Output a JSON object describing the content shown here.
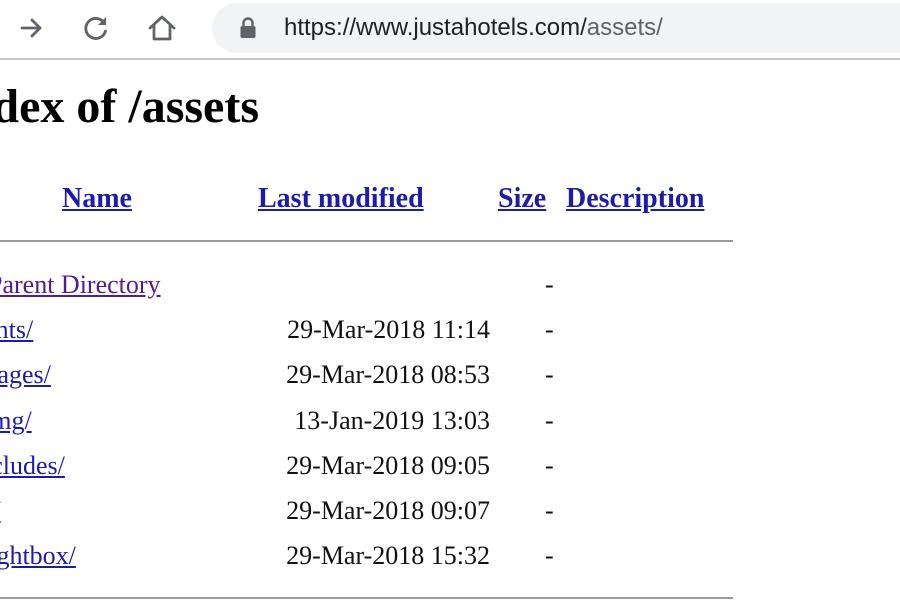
{
  "browser": {
    "url_main": "https://www.justahotels.com/",
    "url_path": "assets/",
    "colors": {
      "omnibox_bg": "#f1f3f4",
      "icon": "#5f6368",
      "link": "#1c1ca8",
      "visited_link": "#551a8b"
    }
  },
  "page": {
    "title": "Index of /assets",
    "columns": {
      "name": "Name",
      "last_modified": "Last modified",
      "size": "Size",
      "description": "Description"
    },
    "rows": [
      {
        "name": "Parent Directory",
        "date": "",
        "size": "-",
        "visited": true
      },
      {
        "name": "fonts/",
        "date": "29-Mar-2018 11:14",
        "size": "-",
        "visited": false
      },
      {
        "name": "images/",
        "date": "29-Mar-2018 08:53",
        "size": "-",
        "visited": false
      },
      {
        "name": "img/",
        "date": "13-Jan-2019 13:03",
        "size": "-",
        "visited": false
      },
      {
        "name": "includes/",
        "date": "29-Mar-2018 09:05",
        "size": "-",
        "visited": false
      },
      {
        "name": "js/",
        "date": "29-Mar-2018 09:07",
        "size": "-",
        "visited": false
      },
      {
        "name": "lightbox/",
        "date": "29-Mar-2018 15:32",
        "size": "-",
        "visited": false
      }
    ]
  }
}
